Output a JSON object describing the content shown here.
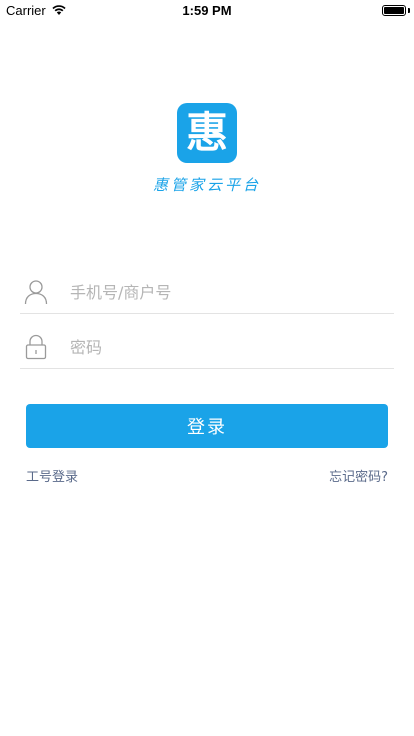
{
  "status_bar": {
    "carrier": "Carrier",
    "time": "1:59 PM",
    "wifi_icon": "wifi-icon",
    "battery_icon": "battery-icon"
  },
  "logo": {
    "char": "惠",
    "app_name": "惠管家云平台",
    "color": "#1aa3e8"
  },
  "form": {
    "phone_placeholder": "手机号/商户号",
    "phone_value": "",
    "password_placeholder": "密码",
    "password_value": "",
    "user_icon": "user-icon",
    "lock_icon": "lock-icon"
  },
  "actions": {
    "login_label": "登录",
    "employee_login": "工号登录",
    "forgot_password": "忘记密码?"
  }
}
